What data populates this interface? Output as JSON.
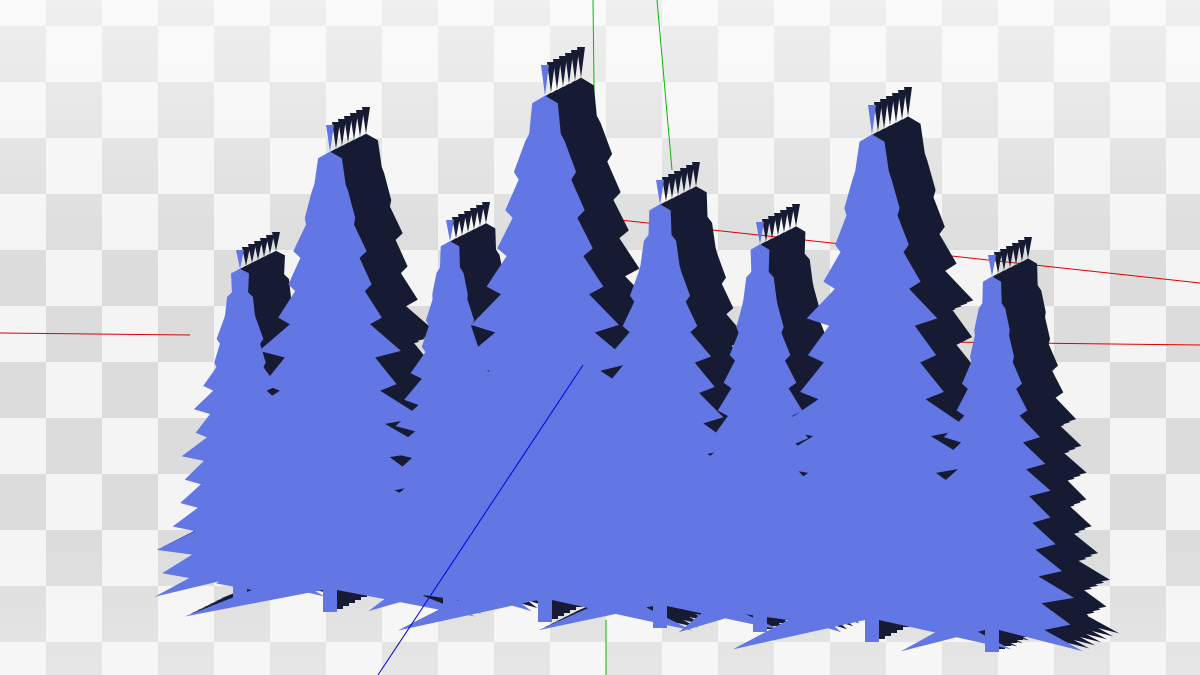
{
  "scene": {
    "model": "pine-tree-forest",
    "colors": {
      "tree_face": "#6276e4",
      "tree_side": "#161b33",
      "axis_x": "#e00000",
      "axis_y": "#00c000",
      "axis_z": "#0000e0",
      "grid_light": "#f4f4f4",
      "grid_dark": "#dcdcdc"
    }
  }
}
